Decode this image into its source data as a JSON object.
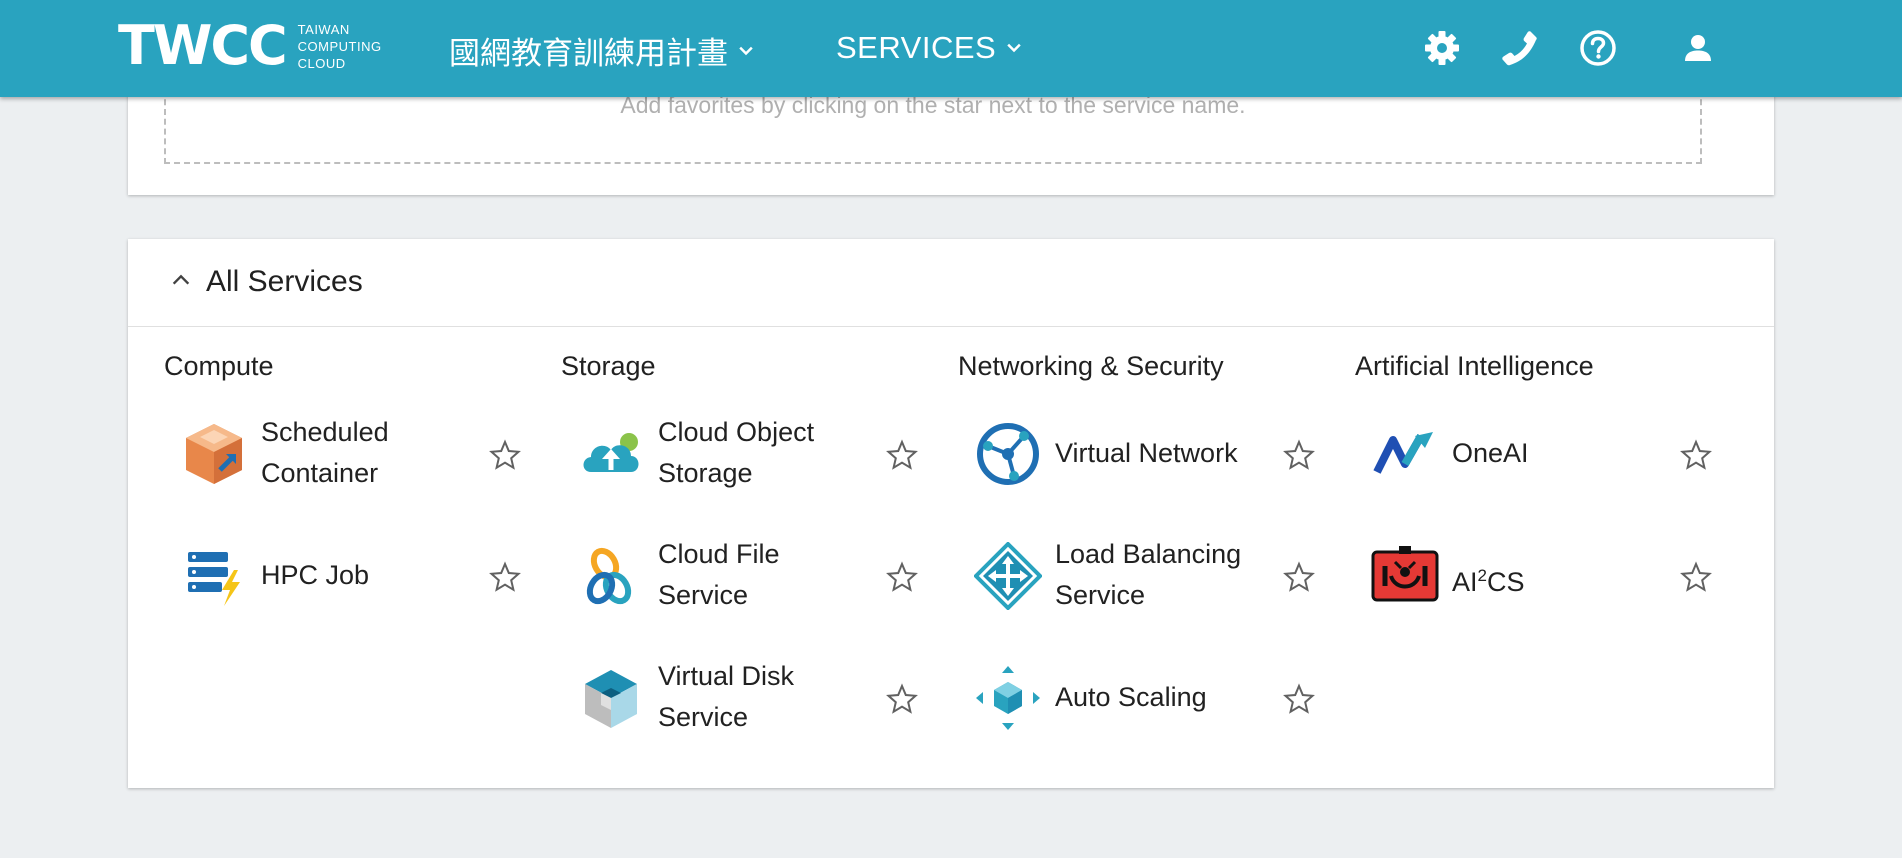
{
  "header": {
    "logo_mark": "TWCC",
    "logo_text": [
      "TAIWAN",
      "COMPUTING",
      "CLOUD"
    ],
    "project": "國網教育訓練用計畫",
    "services": "SERVICES",
    "icons": [
      "gear-icon",
      "phone-icon",
      "help-icon",
      "user-icon"
    ]
  },
  "favorites": {
    "hint": "Add favorites by clicking on the star next to the service name."
  },
  "all_services": {
    "title": "All Services",
    "categories": [
      {
        "name": "Compute",
        "services": [
          {
            "name": "Scheduled Container"
          },
          {
            "name": "HPC Job"
          }
        ]
      },
      {
        "name": "Storage",
        "services": [
          {
            "name": "Cloud Object Storage"
          },
          {
            "name": "Cloud File Service"
          },
          {
            "name": "Virtual Disk Service"
          }
        ]
      },
      {
        "name": "Networking & Security",
        "services": [
          {
            "name": "Virtual Network"
          },
          {
            "name": "Load Balancing Service"
          },
          {
            "name": "Auto Scaling"
          }
        ]
      },
      {
        "name": "Artificial Intelligence",
        "services": [
          {
            "name": "OneAI"
          },
          {
            "name_prefix": "AI",
            "name_sup": "2",
            "name_suffix": "CS"
          }
        ]
      }
    ]
  },
  "colors": {
    "header_bg": "#29a3bf",
    "page_bg": "#eceff1",
    "card_bg": "#ffffff"
  }
}
